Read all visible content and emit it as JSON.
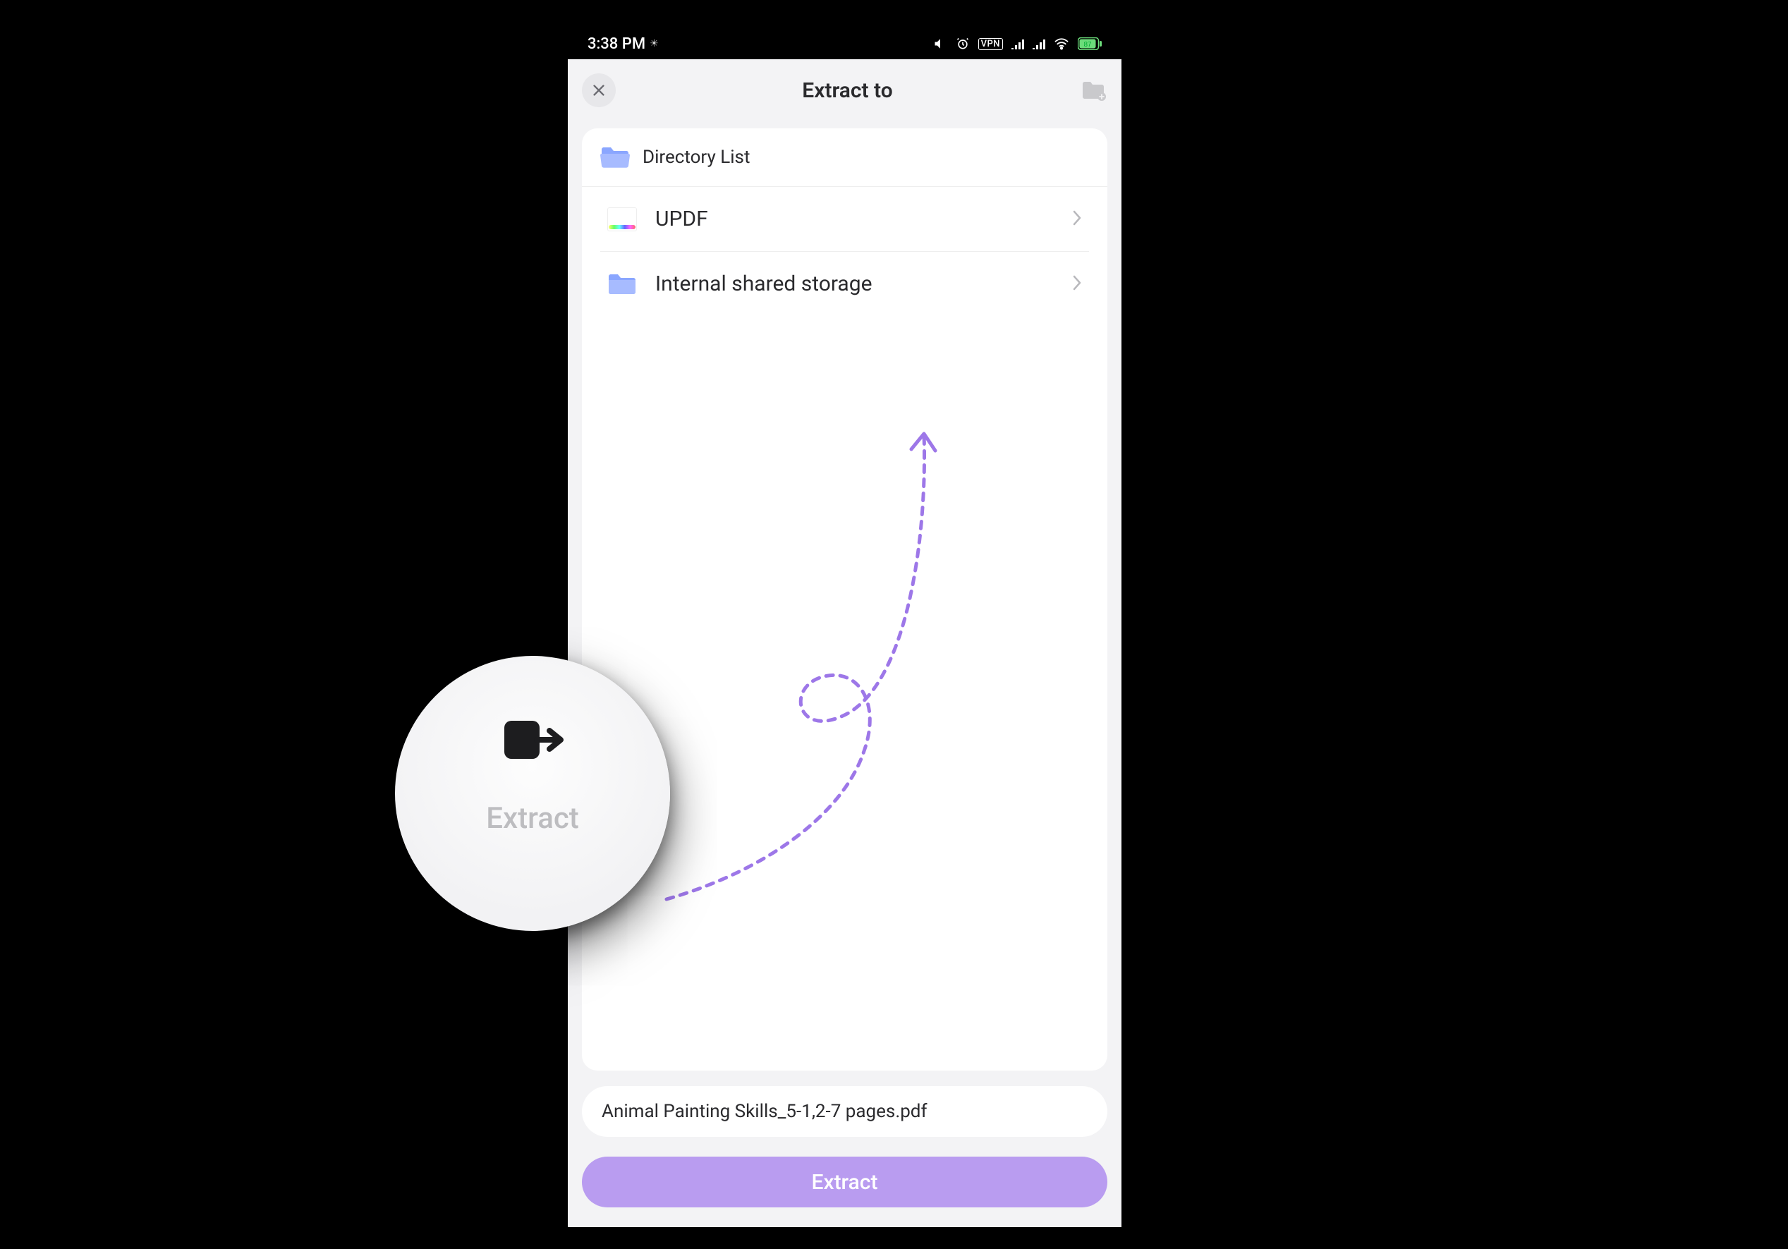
{
  "status": {
    "time": "3:38 PM",
    "vpn_badge": "VPN",
    "battery_level": "87"
  },
  "navbar": {
    "title": "Extract to"
  },
  "directory": {
    "section_label": "Directory List",
    "items": [
      {
        "label": "UPDF",
        "icon": "updf-logo"
      },
      {
        "label": "Internal shared storage",
        "icon": "folder-icon"
      }
    ]
  },
  "filename": "Animal Painting Skills_5-1,2-7 pages.pdf",
  "primary_button": "Extract",
  "callout": {
    "label": "Extract"
  },
  "colors": {
    "accent": "#b99cf0",
    "arrow": "#9d77e8"
  }
}
